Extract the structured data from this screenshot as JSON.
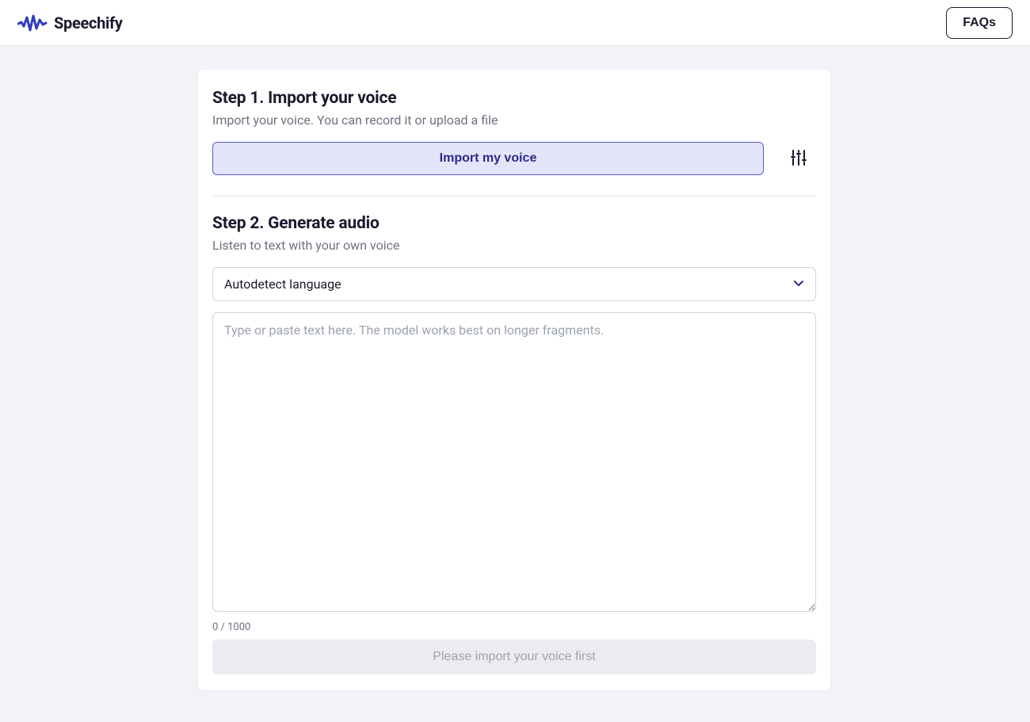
{
  "header": {
    "brand": "Speechify",
    "faqs_label": "FAQs"
  },
  "step1": {
    "title": "Step 1. Import your voice",
    "subtitle": "Import your voice. You can record it or upload a file",
    "import_button_label": "Import my voice",
    "settings_icon": "sliders-icon"
  },
  "step2": {
    "title": "Step 2. Generate audio",
    "subtitle": "Listen to text with your own voice",
    "language_select_value": "Autodetect language",
    "textarea_placeholder": "Type or paste text here. The model works best on longer fragments.",
    "char_counter": "0 / 1000",
    "generate_button_label": "Please import your voice first"
  },
  "colors": {
    "accent": "#2f3cc0",
    "import_bg": "#e4e5fa",
    "page_bg": "#f2f3f7"
  }
}
